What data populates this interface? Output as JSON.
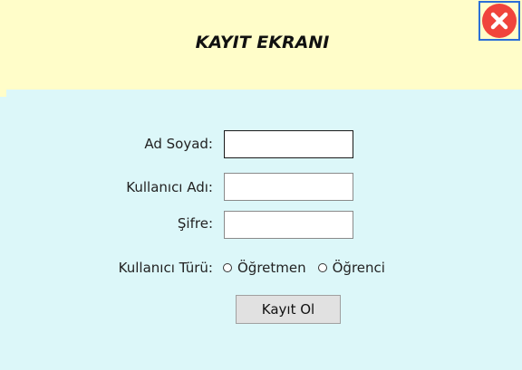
{
  "header": {
    "title": "KAYIT EKRANI"
  },
  "form": {
    "name_label": "Ad Soyad:",
    "name_value": "",
    "username_label": "Kullanıcı Adı:",
    "username_value": "",
    "password_label": "Şifre:",
    "password_value": "",
    "user_type_label": "Kullanıcı Türü:",
    "user_type_options": [
      "Öğretmen",
      "Öğrenci"
    ],
    "user_type_selected": null,
    "submit_label": "Kayıt Ol"
  },
  "colors": {
    "header_bg": "#fffdc9",
    "body_bg": "#dcf7f9",
    "close_icon": "#f0443c",
    "close_border": "#2b6fd6"
  },
  "icons": {
    "close": "close-icon"
  }
}
